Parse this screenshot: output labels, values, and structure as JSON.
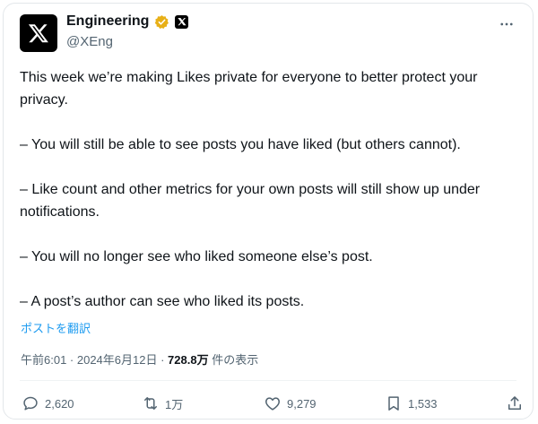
{
  "post": {
    "author_name": "Engineering",
    "author_handle": "@XEng",
    "paragraphs": [
      "This week we’re making Likes private for everyone to better protect your privacy.",
      "– You will still be able to see posts you have liked (but others cannot).",
      "– Like count and other metrics for your own posts will still show up under notifications.",
      "– You will no longer see who liked someone else’s post.",
      "– A post’s author can see who liked its posts."
    ],
    "translate_label": "ポストを翻訳",
    "timestamp": "午前6:01 · 2024年6月12日 · ",
    "views_count": "728.8万",
    "views_label": " 件の表示",
    "actions": {
      "replies": "2,620",
      "reposts": "1万",
      "likes": "9,279",
      "bookmarks": "1,533"
    }
  },
  "icons": {
    "avatar": "x-logo-icon",
    "verified": "verified-badge-icon",
    "affiliate": "x-affiliate-icon",
    "more": "more-icon",
    "reply": "reply-icon",
    "repost": "repost-icon",
    "like": "heart-icon",
    "bookmark": "bookmark-icon",
    "share": "share-icon"
  },
  "colors": {
    "verified": "#e8b017",
    "link": "#1d9bf0",
    "muted": "#536471",
    "text": "#0f1419"
  }
}
